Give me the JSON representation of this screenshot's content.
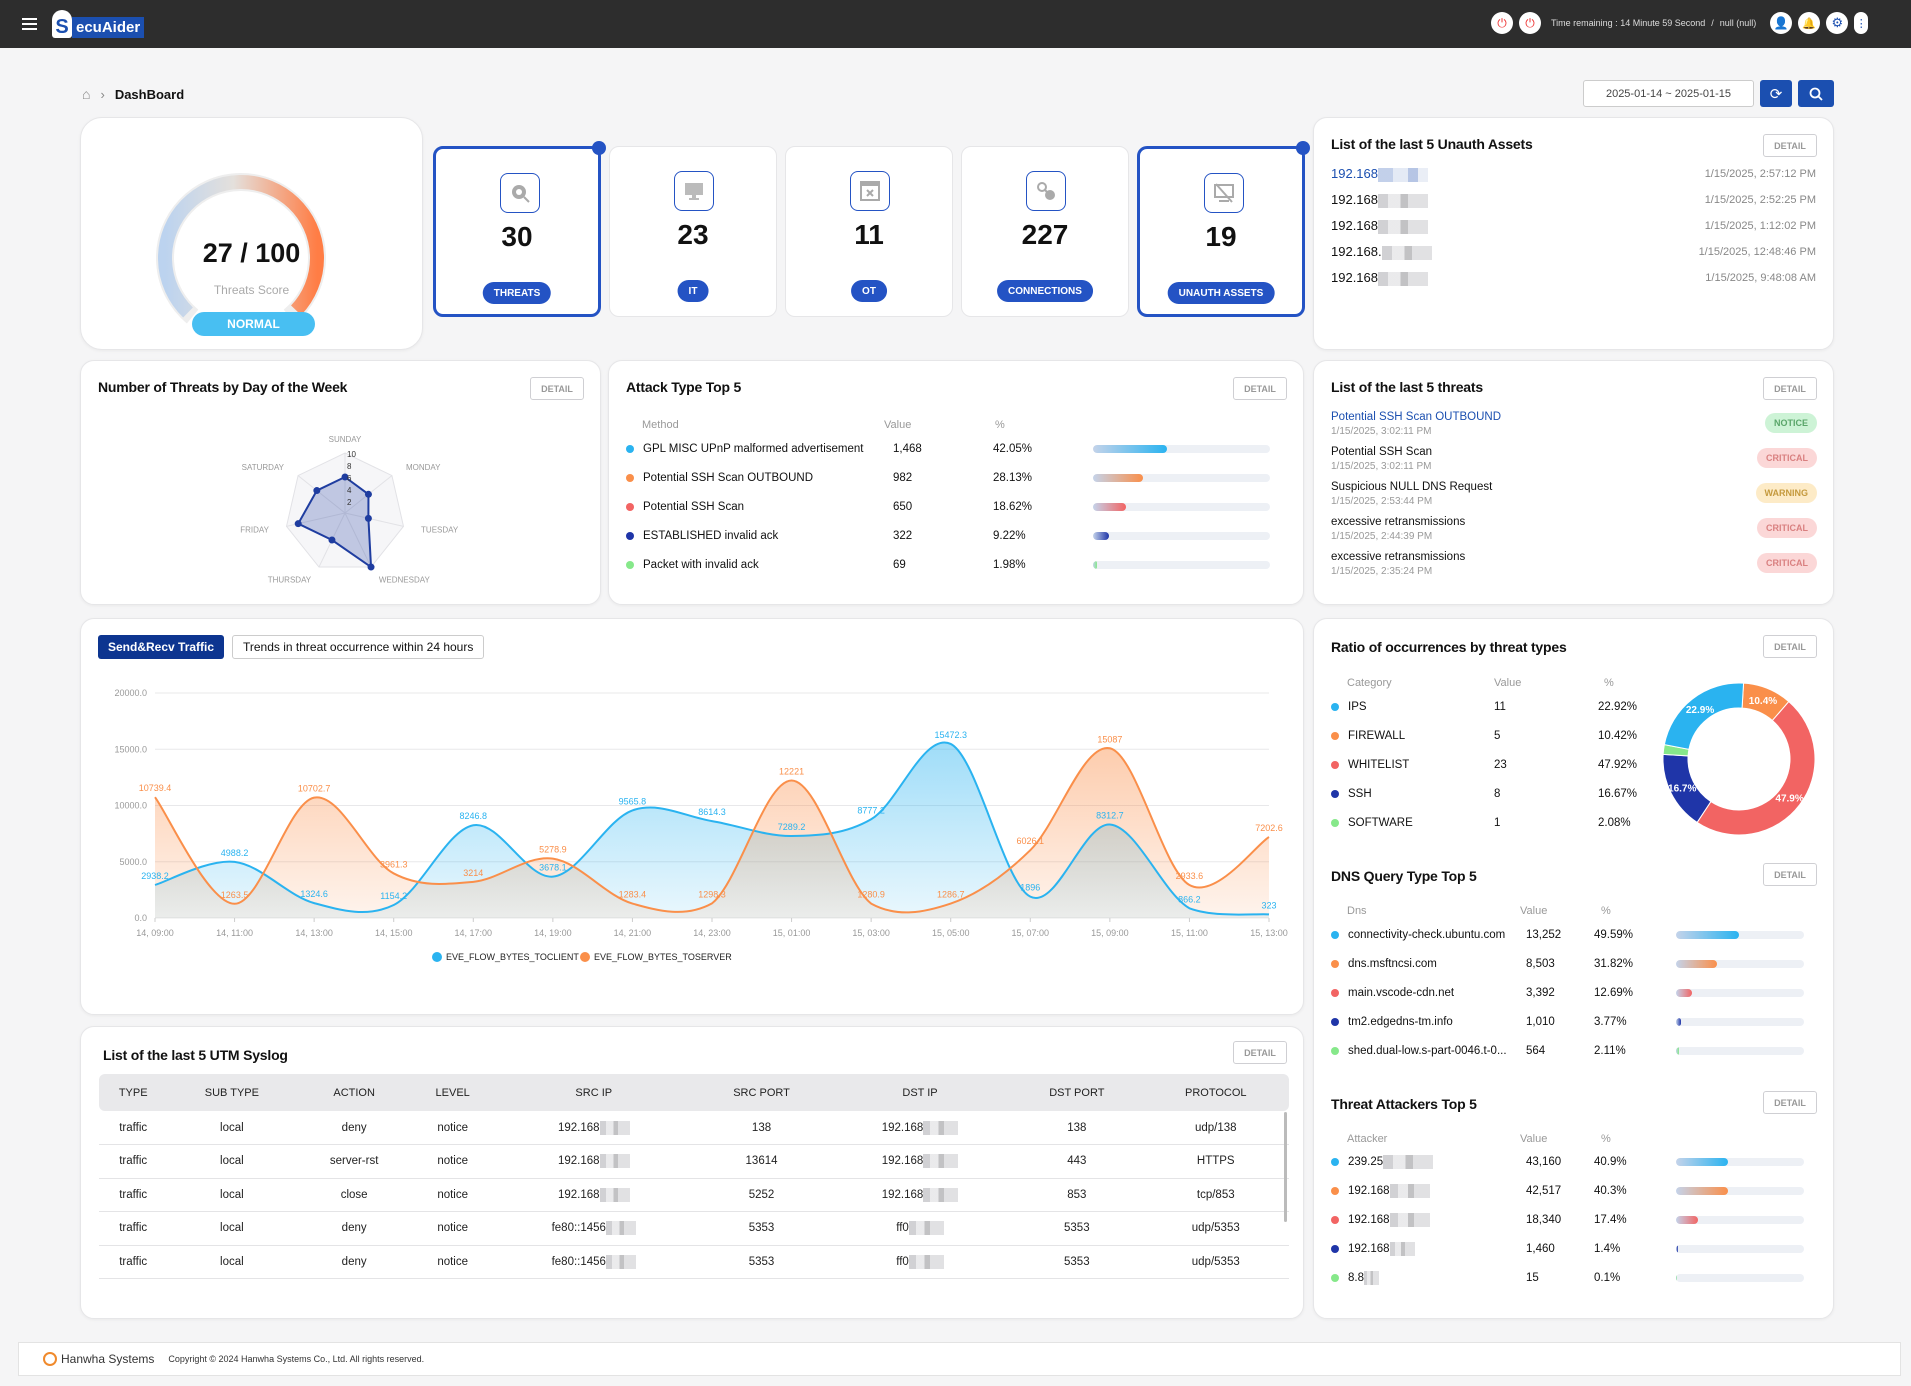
{
  "header": {
    "logo": "SecuAider",
    "time_remaining": "Time remaining : 14 Minute 59 Second",
    "user": "null (null)"
  },
  "breadcrumb": {
    "page": "DashBoard"
  },
  "date_range": "2025-01-14 ~ 2025-01-15",
  "score": {
    "value": "27 / 100",
    "label": "Threats Score",
    "status": "NORMAL",
    "fraction": 0.27
  },
  "stats": [
    {
      "value": "30",
      "label": "THREATS",
      "icon": "bug-search-icon",
      "selected": true
    },
    {
      "value": "23",
      "label": "IT",
      "icon": "monitor-icon",
      "selected": false
    },
    {
      "value": "11",
      "label": "OT",
      "icon": "device-icon",
      "selected": false
    },
    {
      "value": "227",
      "label": "CONNECTIONS",
      "icon": "connection-icon",
      "selected": false
    },
    {
      "value": "19",
      "label": "UNAUTH ASSETS",
      "icon": "monitor-off-icon",
      "selected": true
    }
  ],
  "detail_label": "DETAIL",
  "unauth": {
    "title": "List of the last 5 Unauth Assets",
    "items": [
      {
        "ip": "192.168",
        "time": "1/15/2025, 2:57:12 PM"
      },
      {
        "ip": "192.168",
        "time": "1/15/2025, 2:52:25 PM"
      },
      {
        "ip": "192.168",
        "time": "1/15/2025, 1:12:02 PM"
      },
      {
        "ip": "192.168.",
        "time": "1/15/2025, 12:48:46 PM"
      },
      {
        "ip": "192.168",
        "time": "1/15/2025, 9:48:08 AM"
      }
    ]
  },
  "radar": {
    "title": "Number of Threats by Day of the Week",
    "ticks": [
      "2",
      "4",
      "6",
      "8",
      "10"
    ]
  },
  "attack": {
    "title": "Attack Type Top 5",
    "headers": [
      "Method",
      "Value",
      "%"
    ],
    "items": [
      {
        "name": "GPL MISC UPnP malformed advertisement",
        "value": "1,468",
        "pct": "42.05%",
        "p": 42.05,
        "color": "#2ab3f0"
      },
      {
        "name": "Potential SSH Scan OUTBOUND",
        "value": "982",
        "pct": "28.13%",
        "p": 28.13,
        "color": "#fa8f4a"
      },
      {
        "name": "Potential SSH Scan",
        "value": "650",
        "pct": "18.62%",
        "p": 18.62,
        "color": "#f26463"
      },
      {
        "name": "ESTABLISHED invalid ack",
        "value": "322",
        "pct": "9.22%",
        "p": 9.22,
        "color": "#1f35a8"
      },
      {
        "name": "Packet with invalid ack",
        "value": "69",
        "pct": "1.98%",
        "p": 1.98,
        "color": "#86e88a"
      }
    ]
  },
  "threats": {
    "title": "List of the last 5 threats",
    "items": [
      {
        "name": "Potential SSH Scan OUTBOUND",
        "time": "1/15/2025, 3:02:11 PM",
        "level": "NOTICE",
        "highlight": true
      },
      {
        "name": "Potential SSH Scan",
        "time": "1/15/2025, 3:02:11 PM",
        "level": "CRITICAL"
      },
      {
        "name": "Suspicious NULL DNS Request",
        "time": "1/15/2025, 2:53:44 PM",
        "level": "WARNING"
      },
      {
        "name": "excessive retransmissions",
        "time": "1/15/2025, 2:44:39 PM",
        "level": "CRITICAL"
      },
      {
        "name": "excessive retransmissions",
        "time": "1/15/2025, 2:35:24 PM",
        "level": "CRITICAL"
      }
    ]
  },
  "traffic": {
    "tabs": [
      "Send&Recv Traffic",
      "Trends in threat occurrence within 24 hours"
    ],
    "active_tab": 0
  },
  "ratio": {
    "title": "Ratio of occurrences by threat types",
    "headers": [
      "Category",
      "Value",
      "%"
    ],
    "items": [
      {
        "name": "IPS",
        "value": "11",
        "pct": "22.92%",
        "label": "22.9%",
        "color": "#2ab3f0"
      },
      {
        "name": "FIREWALL",
        "value": "5",
        "pct": "10.42%",
        "label": "10.4%",
        "color": "#fa8f4a"
      },
      {
        "name": "WHITELIST",
        "value": "23",
        "pct": "47.92%",
        "label": "47.9%",
        "color": "#f26463"
      },
      {
        "name": "SSH",
        "value": "8",
        "pct": "16.67%",
        "label": "16.7%",
        "color": "#1f35a8"
      },
      {
        "name": "SOFTWARE",
        "value": "1",
        "pct": "2.08%",
        "label": "",
        "color": "#86e88a"
      }
    ]
  },
  "dns": {
    "title": "DNS Query Type Top 5",
    "headers": [
      "Dns",
      "Value",
      "%"
    ],
    "items": [
      {
        "name": "connectivity-check.ubuntu.com",
        "value": "13,252",
        "pct": "49.59%",
        "p": 49.59,
        "color": "#2ab3f0"
      },
      {
        "name": "dns.msftncsi.com",
        "value": "8,503",
        "pct": "31.82%",
        "p": 31.82,
        "color": "#fa8f4a"
      },
      {
        "name": "main.vscode-cdn.net",
        "value": "3,392",
        "pct": "12.69%",
        "p": 12.69,
        "color": "#f26463"
      },
      {
        "name": "tm2.edgedns-tm.info",
        "value": "1,010",
        "pct": "3.77%",
        "p": 3.77,
        "color": "#1f35a8"
      },
      {
        "name": "shed.dual-low.s-part-0046.t-0...",
        "value": "564",
        "pct": "2.11%",
        "p": 2.11,
        "color": "#86e88a"
      }
    ]
  },
  "attackers": {
    "title": "Threat Attackers Top 5",
    "headers": [
      "Attacker",
      "Value",
      "%"
    ],
    "items": [
      {
        "name": "239.25",
        "value": "43,160",
        "pct": "40.9%",
        "p": 40.9,
        "color": "#2ab3f0"
      },
      {
        "name": "192.168",
        "value": "42,517",
        "pct": "40.3%",
        "p": 40.3,
        "color": "#fa8f4a"
      },
      {
        "name": "192.168",
        "value": "18,340",
        "pct": "17.4%",
        "p": 17.4,
        "color": "#f26463"
      },
      {
        "name": "192.168",
        "value": "1,460",
        "pct": "1.4%",
        "p": 1.4,
        "color": "#1f35a8"
      },
      {
        "name": "8.8",
        "value": "15",
        "pct": "0.1%",
        "p": 0.1,
        "color": "#86e88a"
      }
    ]
  },
  "syslog": {
    "title": "List of the last 5 UTM Syslog",
    "columns": [
      "TYPE",
      "SUB TYPE",
      "ACTION",
      "LEVEL",
      "SRC IP",
      "SRC PORT",
      "DST IP",
      "DST PORT",
      "PROTOCOL"
    ],
    "rows": [
      [
        "traffic",
        "local",
        "deny",
        "notice",
        "192.168",
        "138",
        "192.168",
        "138",
        "udp/138"
      ],
      [
        "traffic",
        "local",
        "server-rst",
        "notice",
        "192.168",
        "13614",
        "192.168",
        "443",
        "HTTPS"
      ],
      [
        "traffic",
        "local",
        "close",
        "notice",
        "192.168",
        "5252",
        "192.168",
        "853",
        "tcp/853"
      ],
      [
        "traffic",
        "local",
        "deny",
        "notice",
        "fe80::1456",
        "5353",
        "ff0",
        "5353",
        "udp/5353"
      ],
      [
        "traffic",
        "local",
        "deny",
        "notice",
        "fe80::1456",
        "5353",
        "ff0",
        "5353",
        "udp/5353"
      ]
    ]
  },
  "footer": {
    "brand": "Hanwha Systems",
    "copyright": "Copyright © 2024 Hanwha Systems Co., Ltd. All rights reserved."
  },
  "chart_data": [
    {
      "type": "area",
      "x": [
        "14, 09:00",
        "14, 11:00",
        "14, 13:00",
        "14, 15:00",
        "14, 17:00",
        "14, 19:00",
        "14, 21:00",
        "14, 23:00",
        "15, 01:00",
        "15, 03:00",
        "15, 05:00",
        "15, 07:00",
        "15, 09:00",
        "15, 11:00",
        "15, 13:00"
      ],
      "yticks": [
        "0.0",
        "5000.0",
        "10000.0",
        "15000.0",
        "20000.0"
      ],
      "ylim": [
        0,
        20000
      ],
      "grid": true,
      "legend": "bottom",
      "series": [
        {
          "name": "EVE_FLOW_BYTES_TOCLIENT",
          "color": "#2ab3f0",
          "values": [
            2938.2,
            4988.2,
            1324.6,
            1154.2,
            8246.8,
            3678.1,
            9565.8,
            8614.3,
            7289.2,
            8777.2,
            15472.3,
            1896,
            8312.7,
            866.2,
            323
          ]
        },
        {
          "name": "EVE_FLOW_BYTES_TOSERVER",
          "color": "#fa8f4a",
          "values": [
            10739.4,
            1263.5,
            10702.7,
            3961.3,
            3214,
            5278.9,
            1283.4,
            1298.3,
            12221,
            1280.9,
            1286.7,
            6026.1,
            15087,
            2933.6,
            7202.6
          ]
        }
      ]
    },
    {
      "type": "radar",
      "categories": [
        "SUNDAY",
        "MONDAY",
        "TUESDAY",
        "WEDNESDAY",
        "THURSDAY",
        "FRIDAY",
        "SATURDAY"
      ],
      "values": [
        6,
        5,
        4,
        10,
        5,
        8,
        6
      ],
      "ylim": [
        0,
        10
      ]
    },
    {
      "type": "pie",
      "categories": [
        "FIREWALL",
        "WHITELIST",
        "SSH",
        "SOFTWARE",
        "IPS"
      ],
      "values": [
        10.42,
        47.92,
        16.67,
        2.08,
        22.92
      ]
    }
  ]
}
